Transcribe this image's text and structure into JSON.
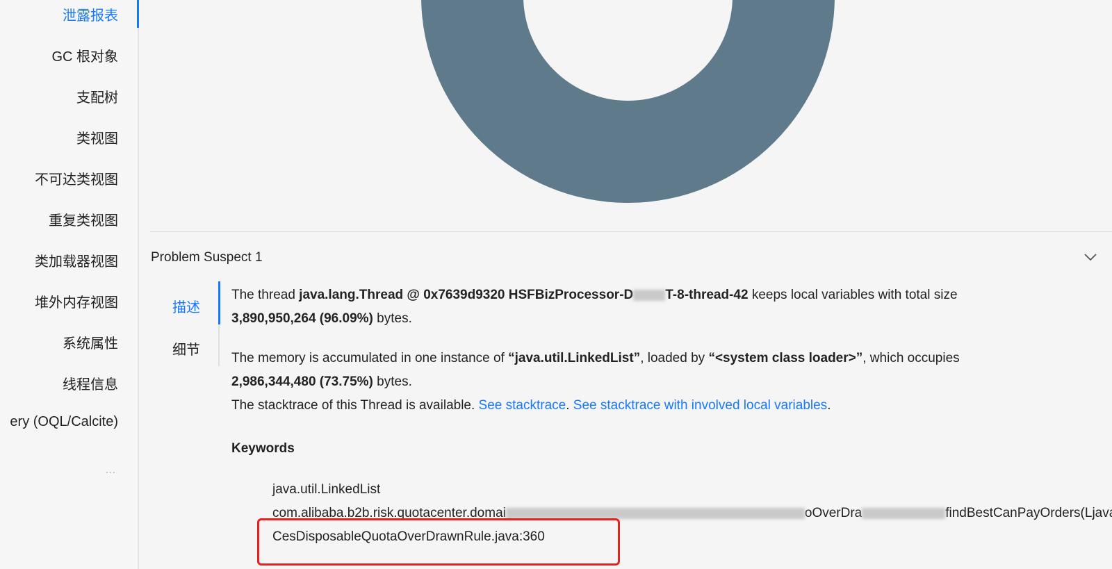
{
  "sidebar": {
    "items": [
      {
        "label": "泄露报表",
        "active": true
      },
      {
        "label": "GC 根对象"
      },
      {
        "label": "支配树"
      },
      {
        "label": "类视图"
      },
      {
        "label": "不可达类视图"
      },
      {
        "label": "重复类视图"
      },
      {
        "label": "类加载器视图"
      },
      {
        "label": "堆外内存视图"
      },
      {
        "label": "系统属性"
      },
      {
        "label": "线程信息"
      },
      {
        "label": "ery (OQL/Calcite)"
      }
    ],
    "more_label": "..."
  },
  "colors": {
    "accent": "#1677ff",
    "donut": "#5f7a8b",
    "highlight": "#e8201e"
  },
  "suspect": {
    "title": "Problem Suspect 1",
    "tabs": [
      {
        "label": "描述",
        "active": true
      },
      {
        "label": "细节"
      }
    ],
    "line1": {
      "prefix": "The thread ",
      "thread": "java.lang.Thread @ 0x7639d9320 HSFBizProcessor-D",
      "thread_suffix": "T-8-thread-42",
      "middle": " keeps local variables with total size"
    },
    "line2": {
      "size": "3,890,950,264 (96.09%)",
      "suffix": " bytes."
    },
    "line3": {
      "prefix": "The memory is accumulated in one instance of ",
      "class": "“java.util.LinkedList”",
      "mid": ", loaded by ",
      "loader": "“<system class loader>”",
      "suffix": ", which occupies"
    },
    "line4": {
      "size": "2,986,344,480 (73.75%)",
      "suffix": " bytes."
    },
    "line5": {
      "prefix": "The stacktrace of this Thread is available. ",
      "link1": "See stacktrace",
      "sep": ". ",
      "link2": "See stacktrace with involved local variables",
      "end": "."
    },
    "keywords_title": "Keywords",
    "keywords": [
      "java.util.LinkedList",
      "com.alibaba.b2b.risk.quotacenter.domai",
      "oOverDra",
      "findBestCanPayOrders(Ljava/util/Lis",
      "CesDisposableQuotaOverDrawnRule.java:360"
    ]
  }
}
